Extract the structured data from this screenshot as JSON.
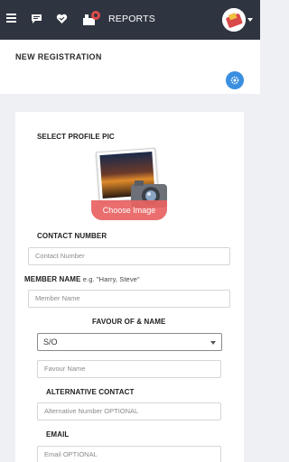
{
  "header": {
    "reports_label": "REPORTS"
  },
  "page": {
    "title": "NEW REGISTRATION"
  },
  "form": {
    "profile_pic_label": "SELECT PROFILE PIC",
    "choose_image_label": "Choose Image",
    "contact_number_label": "CONTACT NUMBER",
    "contact_number_placeholder": "Contact Number",
    "member_name_label": "MEMBER NAME",
    "member_name_hint": "e.g. \"Harry, Steve\"",
    "member_name_placeholder": "Member Name",
    "favour_label": "FAVOUR OF & NAME",
    "favour_select_value": "S/O",
    "favour_name_placeholder": "Favour Name",
    "alt_contact_label": "ALTERNATIVE CONTACT",
    "alt_contact_placeholder": "Alternative Number OPTIONAL",
    "email_label": "EMAIL",
    "email_placeholder": "Email OPTIONAL"
  },
  "colors": {
    "topbar": "#2f3441",
    "accent_blue": "#3a8fe0",
    "choose_button": "#e86262",
    "background": "#eef0f4"
  },
  "icons": [
    "menu-icon",
    "chat-icon",
    "heart-icon",
    "reports-icon",
    "avatar",
    "gear-icon",
    "camera-icon"
  ]
}
